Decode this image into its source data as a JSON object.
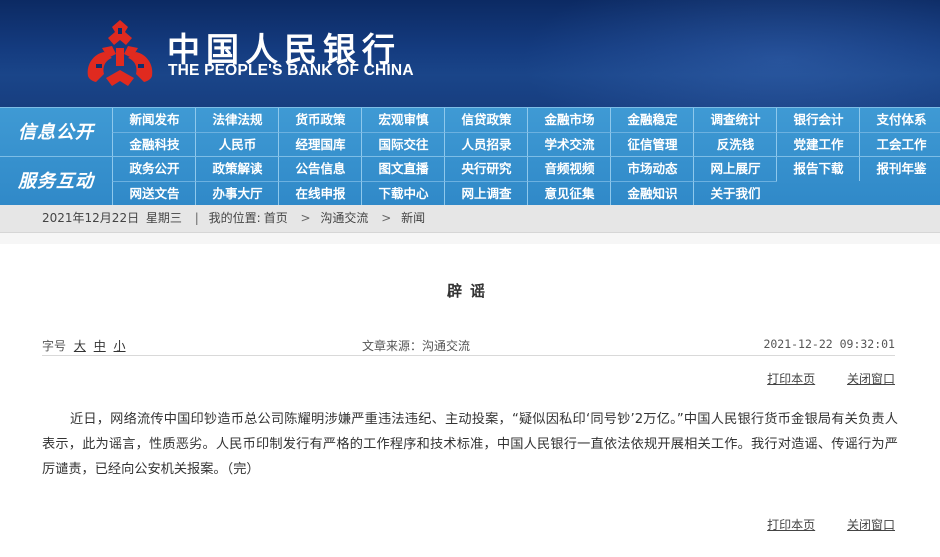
{
  "header": {
    "title_cn": "中国人民银行",
    "title_en": "THE PEOPLE'S BANK OF CHINA",
    "emblem_icon": "pboc-emblem-icon",
    "colors": {
      "header_bg": "#143b7f",
      "emblem": "#e02a1f",
      "nav_bg": "#3089c8"
    }
  },
  "nav": {
    "section1_label": "信息公开",
    "section2_label": "服务互动",
    "section1_row1": [
      "新闻发布",
      "法律法规",
      "货币政策",
      "宏观审慎",
      "信贷政策",
      "金融市场",
      "金融稳定",
      "调查统计",
      "银行会计",
      "支付体系"
    ],
    "section1_row2": [
      "金融科技",
      "人民币",
      "经理国库",
      "国际交往",
      "人员招录",
      "学术交流",
      "征信管理",
      "反洗钱",
      "党建工作",
      "工会工作"
    ],
    "section2_row1": [
      "政务公开",
      "政策解读",
      "公告信息",
      "图文直播",
      "央行研究",
      "音频视频",
      "市场动态",
      "网上展厅",
      "报告下载",
      "报刊年鉴"
    ],
    "section2_row2": [
      "网送文告",
      "办事大厅",
      "在线申报",
      "下载中心",
      "网上调查",
      "意见征集",
      "金融知识",
      "关于我们"
    ]
  },
  "breadcrumb": {
    "date": "2021年12月22日",
    "weekday": "星期三",
    "location_label": "我的位置:",
    "home": "首页",
    "level1": "沟通交流",
    "level2": "新闻",
    "separator": ">"
  },
  "article": {
    "title": "辟谣",
    "font_size_label": "字号",
    "font_large": "大",
    "font_medium": "中",
    "font_small": "小",
    "source": "文章来源：沟通交流",
    "datetime": "2021-12-22 09:32:01",
    "print_label": "打印本页",
    "close_label": "关闭窗口",
    "body": "近日，网络流传中国印钞造币总公司陈耀明涉嫌严重违法违纪、主动投案，“疑似因私印‘同号钞’2万亿。”中国人民银行货币金银局有关负责人表示，此为谣言，性质恶劣。人民币印制发行有严格的工作程序和技术标准，中国人民银行一直依法依规开展相关工作。我行对造谣、传谣行为严厉谴责，已经向公安机关报案。（完）"
  }
}
